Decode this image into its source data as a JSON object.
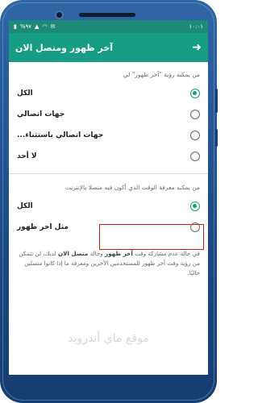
{
  "status_bar": {
    "time": "١٠:٠١",
    "left_text": "%٩٧",
    "icons": [
      "battery-icon",
      "signal-icon",
      "wifi-icon",
      "notification-icon"
    ]
  },
  "appbar": {
    "title": "آخر ظهور ومتصل الان",
    "back_icon": "arrow-right-icon"
  },
  "section1": {
    "title": "من يمكنه رؤية \"آخر ظهور\" لي",
    "options": [
      {
        "label": "الكل",
        "selected": true
      },
      {
        "label": "جهات اتصالي",
        "selected": false
      },
      {
        "label": "جهات اتصالي باستثناء...",
        "selected": false
      },
      {
        "label": "لا أحد",
        "selected": false
      }
    ]
  },
  "section2": {
    "title": "من يمكنه معرفة الوقت الذي أكون فيه متصلا بالإنترنت",
    "options": [
      {
        "label": "الكل",
        "selected": true
      },
      {
        "label": "مثل اخر ظهور",
        "selected": false
      }
    ]
  },
  "footer": {
    "part1": "في حالة عدم مشاركة وقت ",
    "bold1": "آخر ظهور",
    "part2": " وحالة ",
    "bold2": "متصل الان",
    "part3": " لديك، لن تتمكن من رؤية وقت آخر ظهور للمستخدمين الآخرين ومعرفة ما إذا كانوا متصلين حاليًا."
  },
  "watermark": "موقع ماي أندرويد",
  "colors": {
    "accent": "#179c86",
    "status_bar": "#1d8a77",
    "highlight_box": "#d11a1a",
    "phone_frame": "#1d4c86"
  }
}
